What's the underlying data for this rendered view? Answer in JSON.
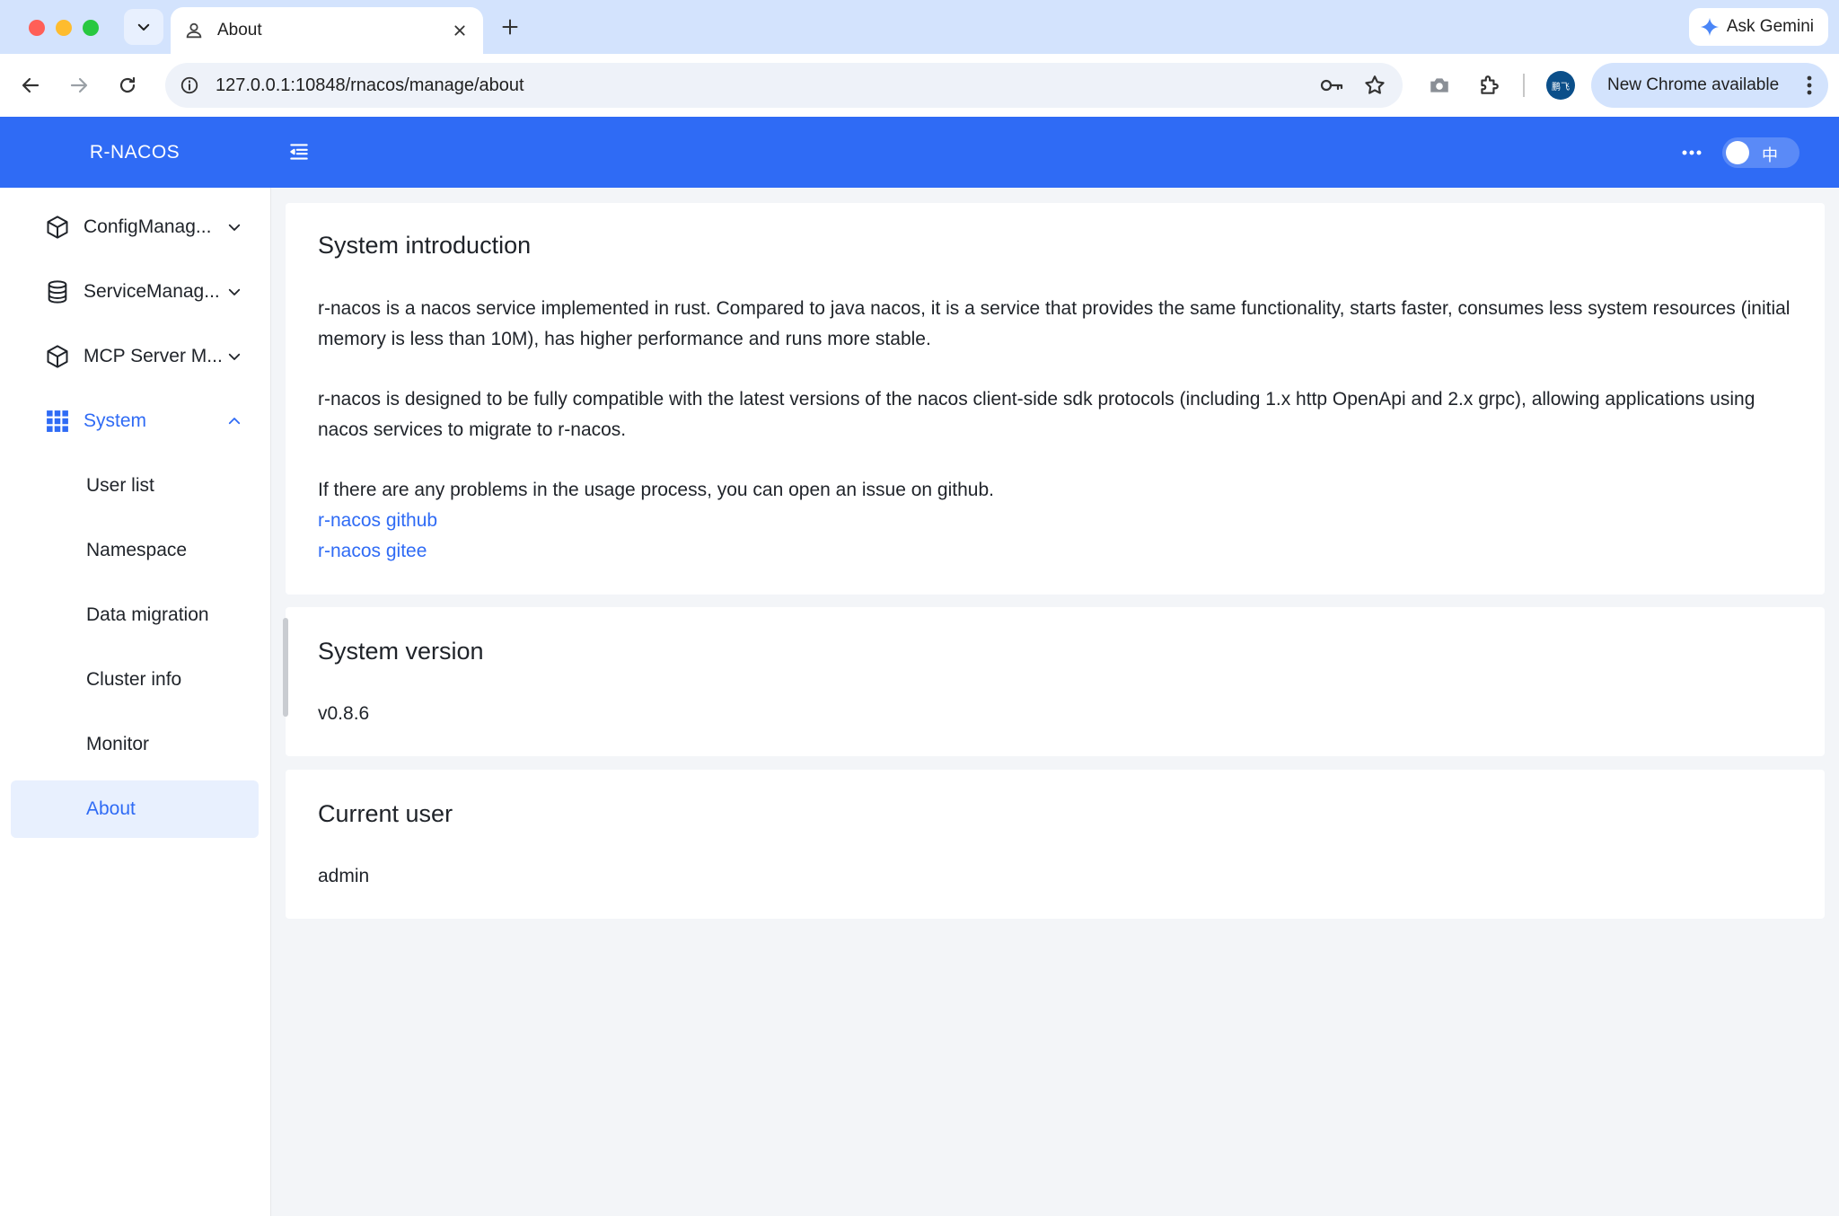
{
  "browser": {
    "tab_title": "About",
    "url": "127.0.0.1:10848/rnacos/manage/about",
    "ask_gemini": "Ask Gemini",
    "update_label": "New Chrome available",
    "profile_initials": "鹏飞"
  },
  "app": {
    "logo": "R-NACOS",
    "lang_toggle": "中",
    "accent_color": "#2f6bf5"
  },
  "sidebar": {
    "items": [
      {
        "label": "ConfigManag...",
        "icon": "cube-icon"
      },
      {
        "label": "ServiceManag...",
        "icon": "database-icon"
      },
      {
        "label": "MCP Server M...",
        "icon": "cube-icon"
      },
      {
        "label": "System",
        "icon": "grid-icon"
      }
    ],
    "system_children": [
      {
        "label": "User list"
      },
      {
        "label": "Namespace"
      },
      {
        "label": "Data migration"
      },
      {
        "label": "Cluster info"
      },
      {
        "label": "Monitor"
      },
      {
        "label": "About"
      }
    ]
  },
  "intro": {
    "title": "System introduction",
    "p1": "r-nacos is a nacos service implemented in rust. Compared to java nacos, it is a service that provides the same functionality, starts faster, consumes less system resources (initial memory is less than 10M), has higher performance and runs more stable.",
    "p2": "r-nacos is designed to be fully compatible with the latest versions of the nacos client-side sdk protocols (including 1.x http OpenApi and 2.x grpc), allowing applications using nacos services to migrate to r-nacos.",
    "p3": "If there are any problems in the usage process, you can open an issue on github.",
    "link_github": "r-nacos github",
    "link_gitee": "r-nacos gitee"
  },
  "version": {
    "title": "System version",
    "value": "v0.8.6"
  },
  "user": {
    "title": "Current user",
    "value": "admin"
  }
}
